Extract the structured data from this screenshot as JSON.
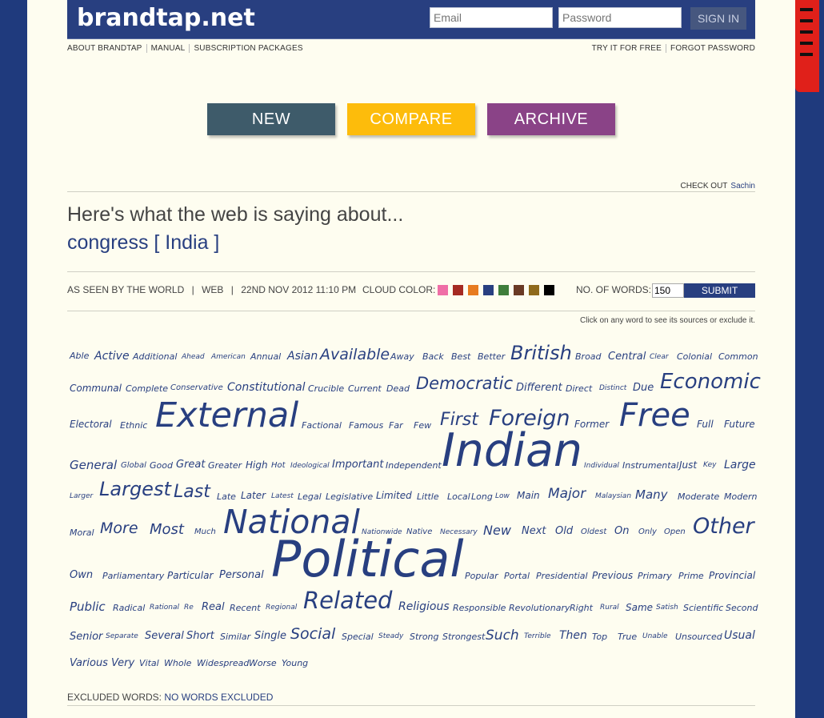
{
  "header": {
    "logo": "brandtap.net",
    "email_placeholder": "Email",
    "password_placeholder": "Password",
    "signin_label": "SIGN IN"
  },
  "nav_left": [
    "ABOUT BRANDTAP",
    "MANUAL",
    "SUBSCRIPTION PACKAGES"
  ],
  "nav_right": [
    "TRY IT FOR FREE",
    "FORGOT PASSWORD"
  ],
  "buttons": {
    "new": {
      "label": "NEW",
      "color": "#3e5b6a"
    },
    "compare": {
      "label": "COMPARE",
      "color": "#fdbc0b"
    },
    "archive": {
      "label": "ARCHIVE",
      "color": "#8a4387"
    }
  },
  "check_out": {
    "label": "CHECK OUT",
    "name": "Sachin"
  },
  "headline": "Here's what the web is saying about...",
  "query": "congress [ India ]",
  "meta": {
    "seen_by": "AS SEEN BY THE WORLD",
    "source": "WEB",
    "date": "22ND NOV 2012 11:10 PM",
    "cloud_color_label": "CLOUD COLOR:",
    "cloud_colors": [
      "#ef6ea6",
      "#a52a22",
      "#e77b20",
      "#283f80",
      "#3f7e3b",
      "#6a3a24",
      "#8f6a1c",
      "#000000"
    ],
    "num_words_label": "NO. OF WORDS:",
    "num_words_value": "150",
    "submit_label": "SUBMIT",
    "hint": "Click on any word to see its sources or exclude it."
  },
  "cloud_words": [
    "Able",
    "Active",
    "Additional",
    "Ahead",
    "American",
    "Annual",
    "Asian",
    "Available",
    "Away",
    "Back",
    "Best",
    "Better",
    "British",
    "Broad",
    "Central",
    "Clear",
    "Colonial",
    "Common",
    "Communal",
    "Complete",
    "Conservative",
    "Constitutional",
    "Crucible",
    "Current",
    "Dead",
    "Democratic",
    "Different",
    "Direct",
    "Distinct",
    "Due",
    "Economic",
    "Electoral",
    "Ethnic",
    "External",
    "Factional",
    "Famous",
    "Far",
    "Few",
    "First",
    "Foreign",
    "Former",
    "Free",
    "Full",
    "Future",
    "General",
    "Global",
    "Good",
    "Great",
    "Greater",
    "High",
    "Hot",
    "Ideological",
    "Important",
    "Independent",
    "Indian",
    "Individual",
    "Instrumental",
    "Just",
    "Key",
    "Large",
    "Larger",
    "Largest",
    "Last",
    "Late",
    "Later",
    "Latest",
    "Legal",
    "Legislative",
    "Limited",
    "Little",
    "Local",
    "Long",
    "Low",
    "Main",
    "Major",
    "Malaysian",
    "Many",
    "Moderate",
    "Modern",
    "Moral",
    "More",
    "Most",
    "Much",
    "National",
    "Nationwide",
    "Native",
    "Necessary",
    "New",
    "Next",
    "Old",
    "Oldest",
    "On",
    "Only",
    "Open",
    "Other",
    "Own",
    "Parliamentary",
    "Particular",
    "Personal",
    "Political",
    "Popular",
    "Portal",
    "Presidential",
    "Previous",
    "Primary",
    "Prime",
    "Provincial",
    "Public",
    "Radical",
    "Rational",
    "Re",
    "Real",
    "Recent",
    "Regional",
    "Related",
    "Religious",
    "Responsible",
    "Revolutionary",
    "Right",
    "Rural",
    "Same",
    "Satish",
    "Scientific",
    "Second",
    "Senior",
    "Separate",
    "Several",
    "Short",
    "Similar",
    "Single",
    "Social",
    "Special",
    "Steady",
    "Strong",
    "Strongest",
    "Such",
    "Terrible",
    "Then",
    "Top",
    "True",
    "Unable",
    "Unsourced",
    "Usual",
    "Various",
    "Very",
    "Vital",
    "Whole",
    "Widespread",
    "Worse",
    "Young"
  ],
  "excluded": {
    "label": "EXCLUDED WORDS:",
    "value": "NO WORDS EXCLUDED"
  }
}
